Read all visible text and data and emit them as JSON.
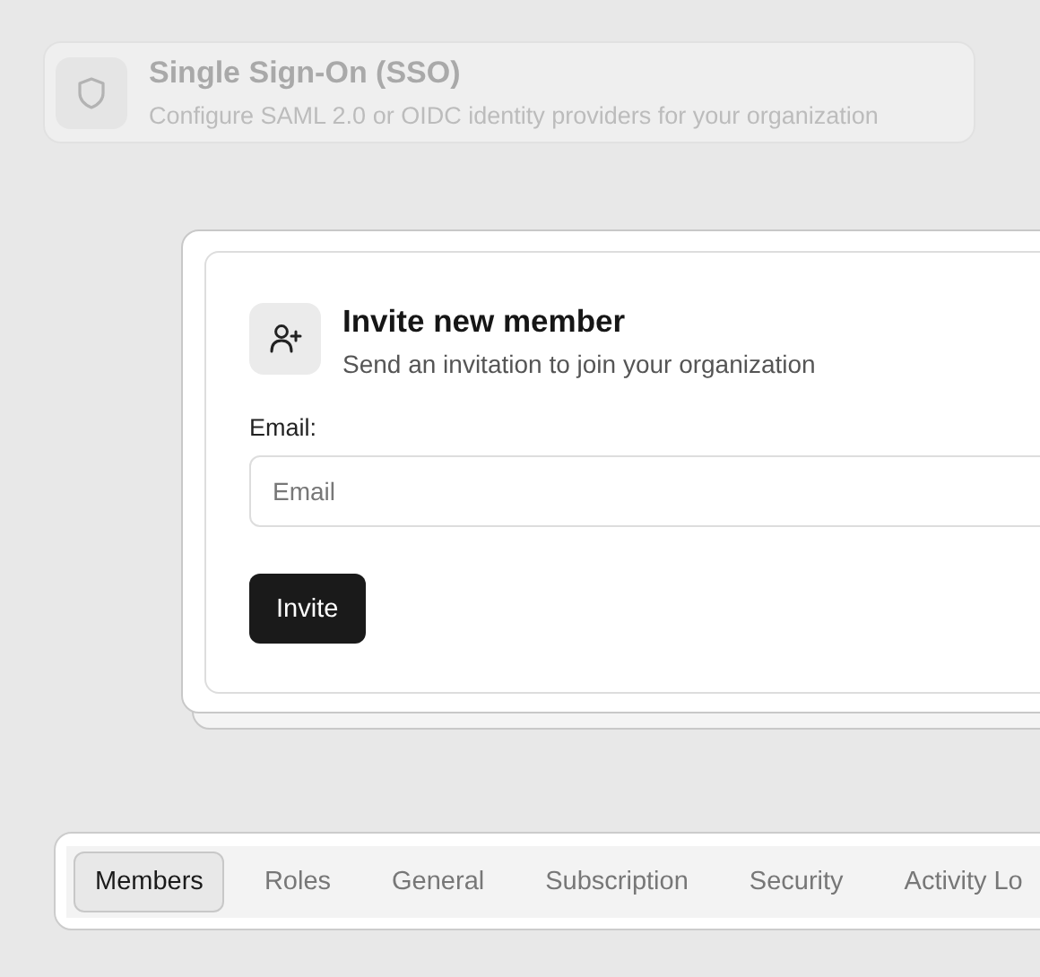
{
  "sso_card": {
    "title": "Single Sign-On (SSO)",
    "description": "Configure SAML 2.0 or OIDC identity providers for your organization",
    "disabled": true
  },
  "invite_card": {
    "title": "Invite new member",
    "subtitle": "Send an invitation to join your organization",
    "email_label": "Email:",
    "email_field": {
      "placeholder": "Email"
    },
    "button": "Invite"
  },
  "tabs": [
    {
      "label": "Members",
      "selected": true
    },
    {
      "label": "Roles",
      "selected": false
    },
    {
      "label": "General",
      "selected": false
    },
    {
      "label": "Subscription",
      "selected": false
    },
    {
      "label": "Security",
      "selected": false
    },
    {
      "label": "Activity Lo",
      "selected": false
    }
  ]
}
